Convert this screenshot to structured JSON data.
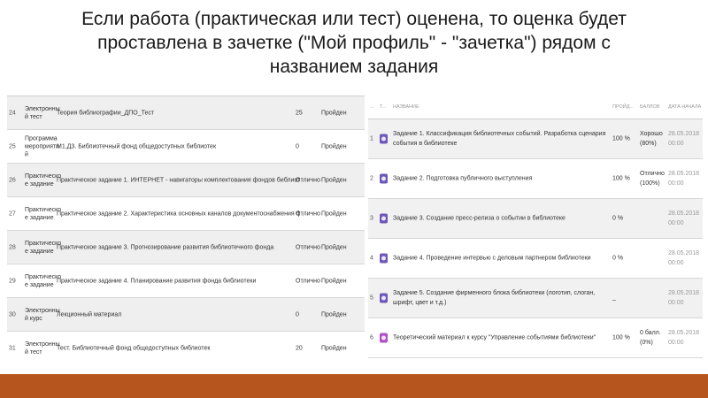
{
  "title": {
    "line1": "Если работа (практическая или тест) оценена, то оценка будет",
    "line2": "проставлена в зачетке (\"Мой профиль\" - \"зачетка\")  рядом с",
    "line3": "названием задания"
  },
  "colors": {
    "accent_bar": "#b7551f",
    "assignment_icon": "#6d57b8",
    "material_icon": "#b14fc4"
  },
  "left_table": {
    "rows": [
      {
        "num": "24",
        "type": "Электронны й тест",
        "name": "Теория библиографии_ДПО_Тест",
        "score": "25",
        "status": "Пройден"
      },
      {
        "num": "25",
        "type": "Программа мероприяти й",
        "name": "М1.Д3. Библиотечный фонд общедоступных библиотек",
        "score": "0",
        "status": "Пройден"
      },
      {
        "num": "26",
        "type": "Практическо е задание",
        "name": "Практическое задание 1. ИНТЕРНЕТ - навигаторы комплектования фондов библиотек.",
        "score": "Отлично",
        "status": "Пройден"
      },
      {
        "num": "27",
        "type": "Практическо е задание",
        "name": "Практическое задание 2. Характеристика основных каналов документоснабжения фондов библиотек",
        "score": "Отлично",
        "status": "Пройден"
      },
      {
        "num": "28",
        "type": "Практическо е задание",
        "name": "Практическое задание 3. Прогнозирование развития библиотечного фонда",
        "score": "Отлично",
        "status": "Пройден"
      },
      {
        "num": "29",
        "type": "Практическо е задание",
        "name": "Практическое задание 4. Планирование развития фонда библиотеки",
        "score": "Отлично",
        "status": "Пройден"
      },
      {
        "num": "30",
        "type": "Электронны й курс",
        "name": "Лекционный материал",
        "score": "0",
        "status": "Пройден"
      },
      {
        "num": "31",
        "type": "Электронны й тест",
        "name": "Тест. Библиотечный фонд общедоступных библиотек",
        "score": "20",
        "status": "Пройден"
      }
    ]
  },
  "right_table": {
    "headers": {
      "num": "...",
      "type": "Т...",
      "name": "НАЗВАНИЕ",
      "progress": "ПРОЙД...",
      "score": "БАЛЛОВ",
      "date": "ДАТА НАЧАЛА"
    },
    "rows": [
      {
        "num": "1",
        "icon": "assignment-icon",
        "name": "Задание 1. Классификация библиотечных событий. Разработка сценария события в библиотеке",
        "progress": "100 %",
        "grade": "Хорошо (80%)",
        "date": "28.05.2018 00:00"
      },
      {
        "num": "2",
        "icon": "assignment-icon",
        "name": "Задание 2. Подготовка публичного выступления",
        "progress": "100 %",
        "grade": "Отлично (100%)",
        "date": "28.05.2018 00:00"
      },
      {
        "num": "3",
        "icon": "assignment-icon",
        "name": "Задание 3. Создание пресс-релиза о событии в библиотеке",
        "progress": "0 %",
        "grade": "",
        "date": "28.05.2018 00:00"
      },
      {
        "num": "4",
        "icon": "assignment-icon",
        "name": "Задание 4. Проведение интервью с деловым партнером библиотеки",
        "progress": "0 %",
        "grade": "",
        "date": "28.05.2018 00:00"
      },
      {
        "num": "5",
        "icon": "assignment-icon",
        "name": "Задание 5. Создание фирменного блока библиотеки (логотип, слоган, шрифт, цвет и т.д.)",
        "progress": "_",
        "grade": "",
        "date": "28.05.2018 00:00"
      },
      {
        "num": "6",
        "icon": "material-icon",
        "name": "Теоретический материал к курсу \"Управление событиями библиотеки\"",
        "progress": "100 %",
        "grade": "0 балл. (0%)",
        "date": "28.05.2018 00:00"
      }
    ]
  }
}
